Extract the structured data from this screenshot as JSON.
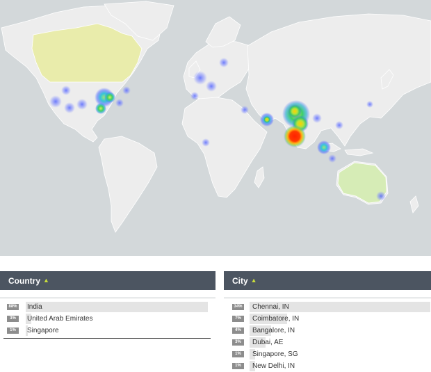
{
  "map": {
    "ocean_color": "#d3d8da",
    "land_color": "#ededed",
    "highlight_color": "#e9ecab",
    "highlight_color_2": "#d6ecb6"
  },
  "country_panel": {
    "title": "Country",
    "download_icon": "download-arrow-icon",
    "rows": [
      {
        "percent": "88%",
        "label": "India",
        "share": 88
      },
      {
        "percent": "3%",
        "label": "United Arab Emirates",
        "share": 3
      },
      {
        "percent": "1%",
        "label": "Singapore",
        "share": 1
      }
    ]
  },
  "city_panel": {
    "title": "City",
    "download_icon": "download-arrow-icon",
    "rows": [
      {
        "percent": "34%",
        "label": "Chennai, IN",
        "share": 34
      },
      {
        "percent": "7%",
        "label": "Coimbatore, IN",
        "share": 7
      },
      {
        "percent": "4%",
        "label": "Bangalore, IN",
        "share": 4
      },
      {
        "percent": "3%",
        "label": "Dubai, AE",
        "share": 3
      },
      {
        "percent": "1%",
        "label": "Singapore, SG",
        "share": 1
      },
      {
        "percent": "1%",
        "label": "New Delhi, IN",
        "share": 1
      }
    ]
  }
}
